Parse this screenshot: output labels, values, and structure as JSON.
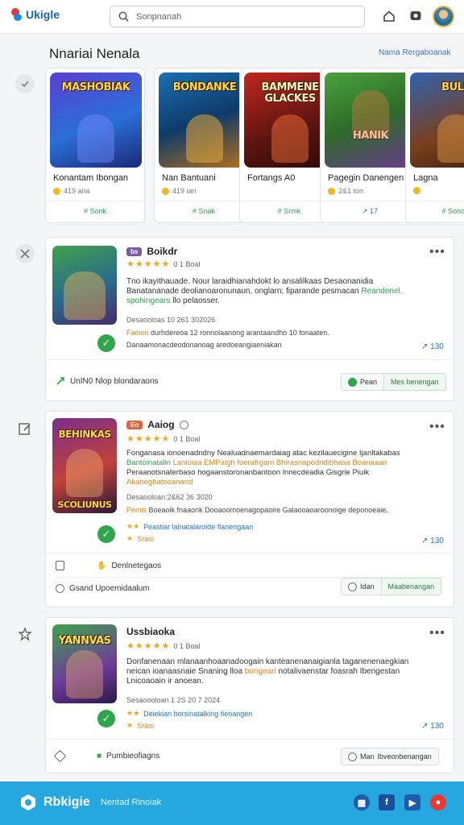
{
  "header": {
    "logo_text": "Ukigle",
    "search_placeholder": "Sonpnanah",
    "icons": [
      "home-icon",
      "chat-icon",
      "avatar"
    ]
  },
  "featured": {
    "title": "Nnariai Nenala",
    "link": "Nama Rergaboanak",
    "games": [
      {
        "art_text": "MASHOBIAK",
        "name": "Konantam Ibongan",
        "meta": "419 ana",
        "action": "# Sonk"
      },
      {
        "art_text": "BONDANKE",
        "name": "Nan Bantuani",
        "meta": "419 ian",
        "action": "# Snak"
      },
      {
        "art_text": "BAMMENE GLACKES",
        "name": "Fortangs A0",
        "meta": "",
        "action": "# Srmk"
      },
      {
        "art_text": "HANIK",
        "name": "Pagegin Danengen",
        "meta": "2&1 ton",
        "action": "↗ 17"
      },
      {
        "art_text": "BULE",
        "name": "Lagna",
        "meta": "",
        "action": "# Sonok"
      }
    ]
  },
  "posts": [
    {
      "thumb_text": "",
      "title": "Boikdr",
      "tag": "bs",
      "rating": "0 1 Boal",
      "desc1": "Tno ikayithauade. Nour laraidhianahdokt lo ansalilkaas Desaonanidia",
      "desc2": "Banatananade deolianoaronunaun, onglarn; fiparande pesmacan",
      "desc2_hl": "Reandenel.",
      "desc3_hl": "spohingears",
      "desc3": "llo pelaosser.",
      "date": "Desaooloas 10 261 302026",
      "line1_hl": "Faoien",
      "line1": "durhdereoa 12 ronnolaanong arantaandho 10 fonaaten.",
      "line2": "Danaamonacdeodonanoag aredoeangiaeniakan",
      "count": "↗ 130",
      "foot": "UnIN0 Nlop blondaraons",
      "btn_left": "Pean",
      "btn_right": "Mes benengan"
    },
    {
      "thumb_text": "BEHINKAS",
      "thumb_bottom": "SCOLIUNUS",
      "title": "Aaiog",
      "tag": "Eo",
      "rating": "0 1 Boal",
      "desc1": "Fonganasa ionoenadndny Nealuadnaemardaiag atac kezilauecigine Ijanltakabas",
      "desc2_hl": "Bantoinatalin",
      "desc2": "Lanioiaa EMPalgh foerafrgam Bhirasnapodndibhasa Boanaaan",
      "desc3": "Peraanotsnaterbaso hogaanstoronanbantoon lnnecdeadia Gisgrie Piuik",
      "desc4_hl": "Akanegbatooanand",
      "date": "Desaooloan:2&62 36 3020",
      "line1_hl": "Pemis",
      "line1": "Boeaoik fnaaonk Dooaoomoenagopaoire Galaooaoaroonoige deponoeaie.",
      "tagline": "Peastiar lalnatalarolde flanengaan",
      "tagline2": "Sraio",
      "count": "↗ 130",
      "foot_a": "Denlnetegaos",
      "foot_b": "Gsand Upoemidaalum",
      "btn_left": "Idan",
      "btn_right": "Maabenangan"
    },
    {
      "thumb_text": "YANNVAS",
      "title": "Ussbiaoka",
      "rating": "0 1 Boal",
      "desc1": "Donfanenaan mlanaanhoaanadoogain kanteanenanaigianla taganenenaegkian",
      "desc2": "neican ioanaasnaie Snaning lloa",
      "desc2_hl": "bongearl",
      "desc2b": "notalivaenstar foasrah Ibengestan",
      "desc3": "Lnicoaoain ir anoean.",
      "date": "Sesaoooloan 1 2S 20 7 2024",
      "tagline": "Deiekian borsinatalking fienangen",
      "tagline2": "Sraio",
      "count": "↗ 130",
      "foot": "Pumbieofiagns",
      "btn_left": "Man",
      "btn_right": "Ibveonbenangan"
    }
  ],
  "footer": {
    "brand": "Rbkigie",
    "subtitle": "Nentad Rinoiak",
    "social": [
      "grid-icon",
      "facebook-icon",
      "video-icon",
      "youtube-icon"
    ]
  },
  "colors": {
    "accent": "#26a7e0",
    "success": "#2ea74b",
    "star": "#f2a51a",
    "link": "#2076c4"
  }
}
